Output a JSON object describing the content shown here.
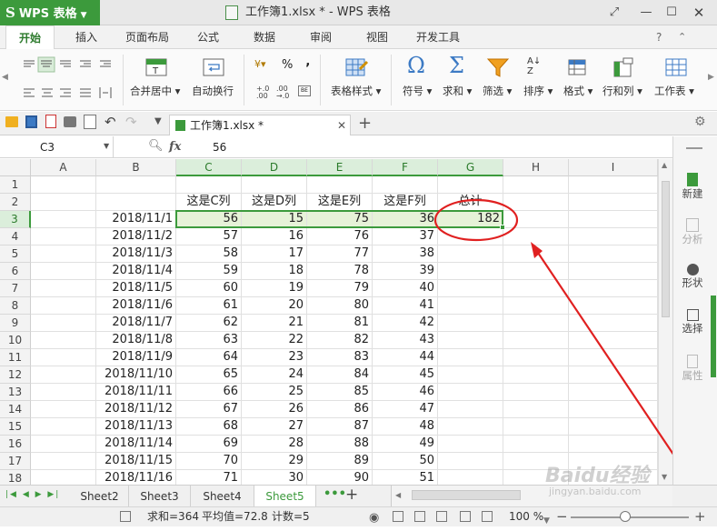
{
  "app": {
    "logo_text": "WPS 表格",
    "window_title": "工作簿1.xlsx * - WPS 表格"
  },
  "menu": [
    "开始",
    "插入",
    "页面布局",
    "公式",
    "数据",
    "审阅",
    "视图",
    "开发工具"
  ],
  "ribbon": {
    "merge_center": "合并居中",
    "wrap_text": "自动换行",
    "table_style": "表格样式",
    "symbol": "符号",
    "sum": "求和",
    "filter": "筛选",
    "sort": "排序",
    "format": "格式",
    "row_col": "行和列",
    "worksheet": "工作表",
    "percent": "%",
    "comma": "‚",
    "dec_inc": "+.0 .00",
    "dec_dec": ".00 →.0"
  },
  "doc_tab": "工作簿1.xlsx *",
  "formula": {
    "name_box": "C3",
    "fx": "fx",
    "value": "56"
  },
  "grid": {
    "columns": [
      "A",
      "B",
      "C",
      "D",
      "E",
      "F",
      "G",
      "H",
      "I"
    ],
    "rows": [
      {
        "n": "1",
        "cells": [
          "",
          "",
          "",
          "",
          "",
          "",
          ""
        ]
      },
      {
        "n": "2",
        "cells": [
          "",
          "",
          "这是C列",
          "这是D列",
          "这是E列",
          "这是F列",
          "总计"
        ]
      },
      {
        "n": "3",
        "cells": [
          "",
          "2018/11/1",
          "56",
          "15",
          "75",
          "36",
          "182"
        ]
      },
      {
        "n": "4",
        "cells": [
          "",
          "2018/11/2",
          "57",
          "16",
          "76",
          "37",
          ""
        ]
      },
      {
        "n": "5",
        "cells": [
          "",
          "2018/11/3",
          "58",
          "17",
          "77",
          "38",
          ""
        ]
      },
      {
        "n": "6",
        "cells": [
          "",
          "2018/11/4",
          "59",
          "18",
          "78",
          "39",
          ""
        ]
      },
      {
        "n": "7",
        "cells": [
          "",
          "2018/11/5",
          "60",
          "19",
          "79",
          "40",
          ""
        ]
      },
      {
        "n": "8",
        "cells": [
          "",
          "2018/11/6",
          "61",
          "20",
          "80",
          "41",
          ""
        ]
      },
      {
        "n": "9",
        "cells": [
          "",
          "2018/11/7",
          "62",
          "21",
          "81",
          "42",
          ""
        ]
      },
      {
        "n": "10",
        "cells": [
          "",
          "2018/11/8",
          "63",
          "22",
          "82",
          "43",
          ""
        ]
      },
      {
        "n": "11",
        "cells": [
          "",
          "2018/11/9",
          "64",
          "23",
          "83",
          "44",
          ""
        ]
      },
      {
        "n": "12",
        "cells": [
          "",
          "2018/11/10",
          "65",
          "24",
          "84",
          "45",
          ""
        ]
      },
      {
        "n": "13",
        "cells": [
          "",
          "2018/11/11",
          "66",
          "25",
          "85",
          "46",
          ""
        ]
      },
      {
        "n": "14",
        "cells": [
          "",
          "2018/11/12",
          "67",
          "26",
          "86",
          "47",
          ""
        ]
      },
      {
        "n": "15",
        "cells": [
          "",
          "2018/11/13",
          "68",
          "27",
          "87",
          "48",
          ""
        ]
      },
      {
        "n": "16",
        "cells": [
          "",
          "2018/11/14",
          "69",
          "28",
          "88",
          "49",
          ""
        ]
      },
      {
        "n": "17",
        "cells": [
          "",
          "2018/11/15",
          "70",
          "29",
          "89",
          "50",
          ""
        ]
      },
      {
        "n": "18",
        "cells": [
          "",
          "2018/11/16",
          "71",
          "30",
          "90",
          "51",
          ""
        ]
      }
    ]
  },
  "right_panel": [
    {
      "label": "新建",
      "enabled": true
    },
    {
      "label": "分析",
      "enabled": false
    },
    {
      "label": "形状",
      "enabled": true
    },
    {
      "label": "选择",
      "enabled": true
    },
    {
      "label": "属性",
      "enabled": false
    }
  ],
  "sheets": [
    "Sheet2",
    "Sheet3",
    "Sheet4",
    "Sheet5"
  ],
  "active_sheet": "Sheet5",
  "status": {
    "sum": "求和=364",
    "avg": "平均值=72.8",
    "count": "计数=5",
    "zoom": "100 %"
  },
  "watermark": {
    "main": "Baidu经验",
    "sub": "jingyan.baidu.com"
  },
  "colors": {
    "accent": "#3c9a3c",
    "annotation": "#e02020"
  }
}
